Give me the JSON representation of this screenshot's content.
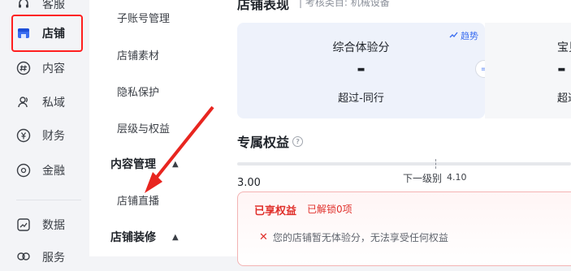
{
  "rail": {
    "items": [
      {
        "label": "客服",
        "icon": "headset-icon"
      },
      {
        "label": "店铺",
        "icon": "store-icon"
      },
      {
        "label": "内容",
        "icon": "hashtag-icon"
      },
      {
        "label": "私域",
        "icon": "users-icon"
      },
      {
        "label": "财务",
        "icon": "yen-icon"
      },
      {
        "label": "金融",
        "icon": "coin-icon"
      },
      {
        "label": "数据",
        "icon": "chart-icon"
      },
      {
        "label": "服务",
        "icon": "service-icon"
      }
    ]
  },
  "menu": {
    "items": [
      {
        "label": "子账号管理"
      },
      {
        "label": "店铺素材"
      },
      {
        "label": "隐私保护"
      },
      {
        "label": "层级与权益"
      }
    ],
    "section_content": "内容管理",
    "live_label": "店铺直播",
    "section_decoration": "店铺装修"
  },
  "main": {
    "shop_title": "店铺表现",
    "shop_sub": "| 考核类目: 机械设备",
    "trend_label": "趋势",
    "score_label": "综合体验分",
    "score_value": "-",
    "score_beat": "超过-同行",
    "eq_symbol": "=",
    "card2_label": "宝贝",
    "card2_value": "-",
    "card2_beat": "超过",
    "rights_title": "专属权益",
    "current_score": "3.00",
    "next_level_label": "下一级别",
    "next_level_score": "4.10",
    "enjoyed_title": "已享权益",
    "enjoyed_count": "已解锁0项",
    "enjoyed_message": "您的店铺暂无体验分，无法享受任何权益"
  },
  "colors": {
    "highlight": "#ff1f1f",
    "accent_blue": "#3a6df0",
    "enjoyed_red": "#e0302b"
  }
}
